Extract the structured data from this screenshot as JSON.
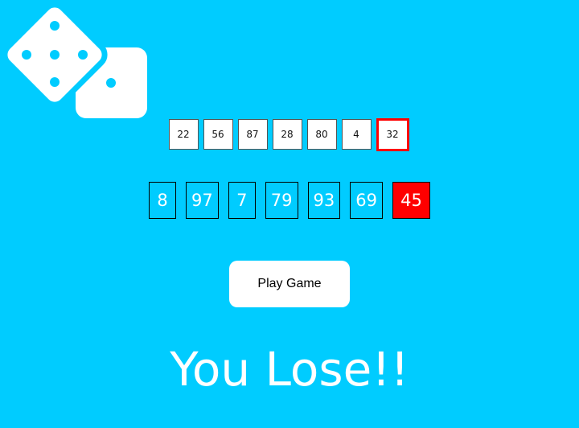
{
  "theme": {
    "background": "#00ccff",
    "highlight": "#ff0000",
    "dice_color": "#ffffff"
  },
  "logo": {
    "icon": "dice-icon"
  },
  "previous_numbers": [
    "22",
    "56",
    "87",
    "28",
    "80",
    "4",
    "32"
  ],
  "current_numbers": [
    "8",
    "97",
    "7",
    "79",
    "93",
    "69",
    "45"
  ],
  "play_button_label": "Play Game",
  "result_text": "You Lose!!"
}
